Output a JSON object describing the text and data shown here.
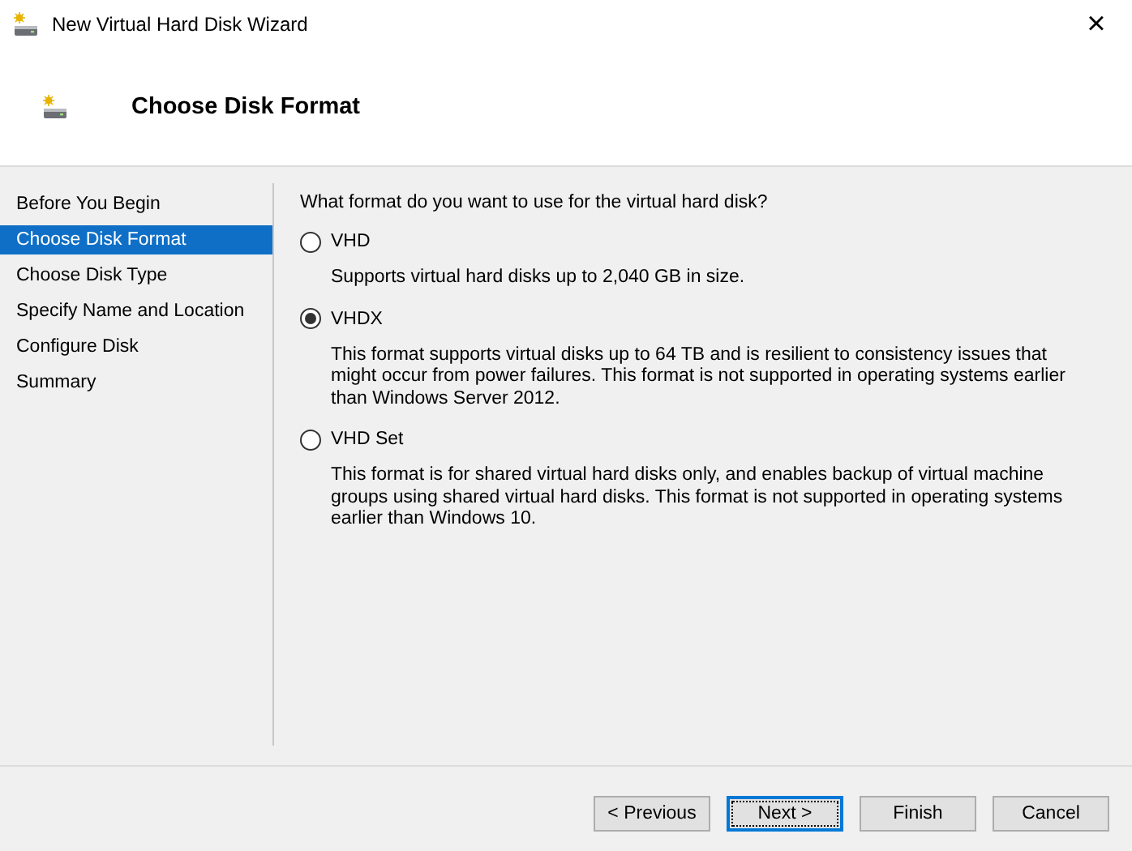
{
  "window": {
    "title": "New Virtual Hard Disk Wizard",
    "close": "×"
  },
  "header": {
    "title": "Choose Disk Format"
  },
  "sidebar": {
    "items": [
      {
        "label": "Before You Begin",
        "selected": false
      },
      {
        "label": "Choose Disk Format",
        "selected": true
      },
      {
        "label": "Choose Disk Type",
        "selected": false
      },
      {
        "label": "Specify Name and Location",
        "selected": false
      },
      {
        "label": "Configure Disk",
        "selected": false
      },
      {
        "label": "Summary",
        "selected": false
      }
    ]
  },
  "content": {
    "question": "What format do you want to use for the virtual hard disk?",
    "options": [
      {
        "label": "VHD",
        "selected": false,
        "description": "Supports virtual hard disks up to 2,040 GB in size."
      },
      {
        "label": "VHDX",
        "selected": true,
        "description": "This format supports virtual disks up to 64 TB and is resilient to consistency issues that might occur from power failures. This format is not supported in operating systems earlier than Windows Server 2012."
      },
      {
        "label": "VHD Set",
        "selected": false,
        "description": "This format is for shared virtual hard disks only, and enables backup of virtual machine groups using shared virtual hard disks. This format is not supported in operating systems earlier than Windows 10."
      }
    ]
  },
  "buttons": [
    {
      "label": "< Previous",
      "default": false
    },
    {
      "label": "Next >",
      "default": true
    },
    {
      "label": "Finish",
      "default": false
    },
    {
      "label": "Cancel",
      "default": false
    }
  ]
}
